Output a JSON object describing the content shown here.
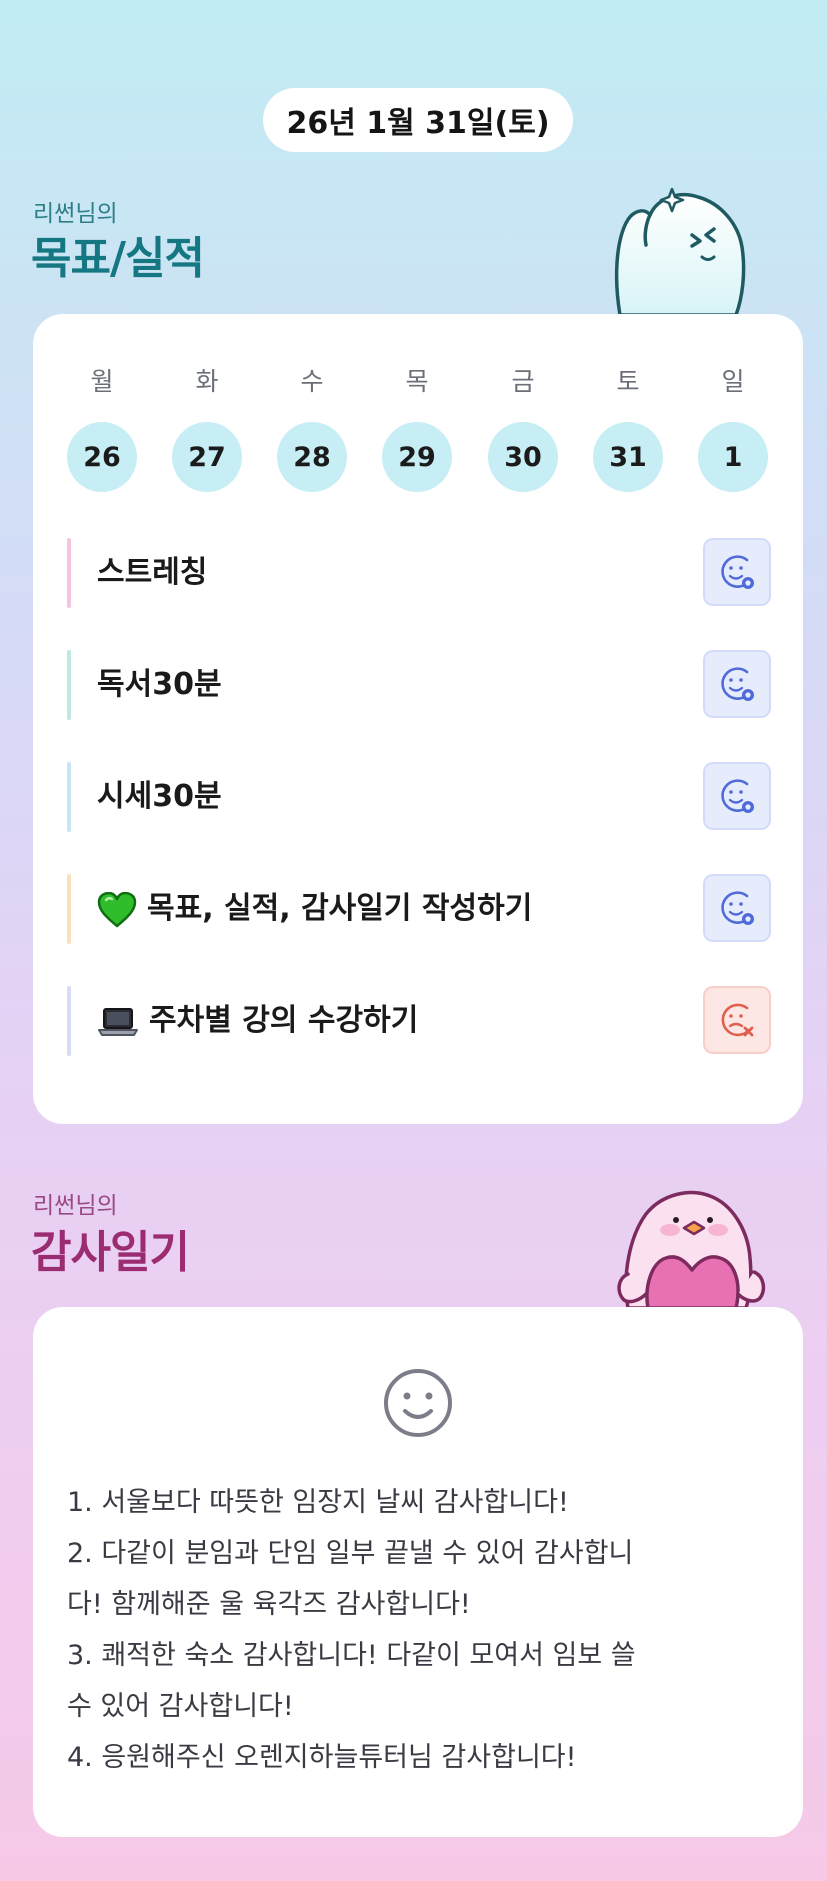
{
  "date": "26년 1월 31일(토)",
  "goals_section": {
    "subtitle": "리썬님의",
    "title": "목표/실적"
  },
  "week": {
    "days": [
      {
        "label": "월",
        "num": "26"
      },
      {
        "label": "화",
        "num": "27"
      },
      {
        "label": "수",
        "num": "28"
      },
      {
        "label": "목",
        "num": "29"
      },
      {
        "label": "금",
        "num": "30"
      },
      {
        "label": "토",
        "num": "31"
      },
      {
        "label": "일",
        "num": "1"
      }
    ]
  },
  "goals": [
    {
      "text": "스트레칭",
      "bar_color": "#f5c4e0",
      "status": "done",
      "icon": ""
    },
    {
      "text": "독서30분",
      "bar_color": "#bfe8e4",
      "status": "done",
      "icon": ""
    },
    {
      "text": "시세30분",
      "bar_color": "#c5e6f2",
      "status": "done",
      "icon": ""
    },
    {
      "text": "목표, 실적, 감사일기 작성하기",
      "bar_color": "#fbe0bd",
      "status": "done",
      "icon": "green-heart-icon"
    },
    {
      "text": "주차별 강의 수강하기",
      "bar_color": "#d6dcf6",
      "status": "not-done",
      "icon": "laptop-icon"
    }
  ],
  "gratitude_section": {
    "subtitle": "리썬님의",
    "title": "감사일기"
  },
  "gratitude": {
    "lines": [
      "1. 서울보다 따뜻한 임장지 날씨 감사합니다!",
      "2. 다같이 분임과 단임 일부 끝낼 수 있어 감사합니",
      "다! 함께해준 울 육각즈 감사합니다!",
      "3. 쾌적한 숙소 감사합니다! 다같이 모여서 임보 쓸",
      "수 있어 감사합니다!",
      "4. 응원해주신 오렌지하늘튜터님 감사합니다!"
    ]
  },
  "colors": {
    "goal_accent": "#157781",
    "gratitude_accent": "#9c2c72",
    "done_icon": "#4f6bd9",
    "not_done_icon": "#e0604e"
  }
}
